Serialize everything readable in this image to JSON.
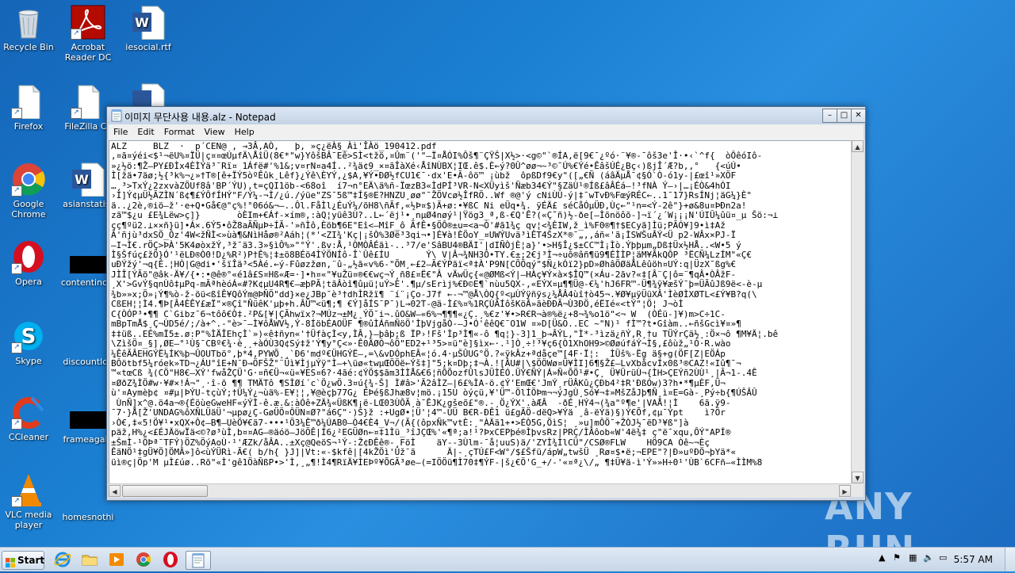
{
  "desktop": {
    "icons": [
      {
        "label": "Recycle Bin"
      },
      {
        "label": "Acrobat Reader DC"
      },
      {
        "label": "iesocial.rtf"
      },
      {
        "label": "Firefox"
      },
      {
        "label": "FileZilla Cli"
      },
      {
        "label": "Google Chrome"
      },
      {
        "label": "asianstatist"
      },
      {
        "label": "Opera"
      },
      {
        "label": "contentinclu"
      },
      {
        "label": "Skype"
      },
      {
        "label": "discountloa"
      },
      {
        "label": "CCleaner"
      },
      {
        "label": "frameagain"
      },
      {
        "label": "VLC media player"
      },
      {
        "label": "homesnothi"
      }
    ]
  },
  "notepad": {
    "title": "이미지 무단사용 내용.alz - Notepad",
    "menu": [
      "File",
      "Edit",
      "Format",
      "View",
      "Help"
    ],
    "buttons": {
      "minimize": "–",
      "maximize": "□",
      "close": "✕"
    },
    "content": "ALZ     BLZ  ·  p´CEN@ , →3Â,AÒ,   þ, »ç¿ëÀ§_Àì'ÎÀö_190412.pdf\n‚¤ã¤ýéi<$¹¬ëU%¤ÏÜ|ç¤¤œÚµfÄ\\ÅîÜ(8€*\"w}YôšBÂ¯Eê>SÌ<tžö,¤Ûm¨('\"—Ï¤ÅÓI%Ôš¶¨ÇŸŠ|X½>·<g©\"`®ÍA,ë[9€¯¿ºó·¨¥®-¯ôš3e'Î·•‹`^f{  òÔêóIô-\n»¿½ö:¶Ž–PY£ÐÌx4ÈÌÝä³¯Rï¤ 1Áfë#'%1&;v¤rN¤a4Í..²¾ä¢9_×¤ãÎàXé‹ÅîNÙBX¦IŒ.ê$.È←ý?0Û^øø¬~³©¯Ú%€Ýé•ÊâšÚÉ¿Bç‹)ßjÎ´Æ?b‚,°   {<úÚ•\nÌ[žä•7äø;½{³k%¬¿»†T®[ê+ÏÝ5òºÊûk¸Lêf}¿Ýê\\ÈYÝ,¿$A,¥Ý•ÐØ½fCU1€¯·dx'E•Ã-ôö™ ¡ùbž  ôpßDf9€y\"([„€Ñ (áâÄµÅ¯¢§Ó`Ò-ó1y-|£œî¹»XÖF\n…¸³>TxÝ¿2zxvàZÖUf8â'BP´ÝU),t=çQI1öb-<68oî  í7¬n°EÄ\\ä%ñ-ÏœzB3«ÌdPÍ³VR-N<XÜyìš'Ñæb34€Ý\"§ZäÙ¹®Íß£âÂÉá—!³fNÀ Ý—›|…¡ÉÒ&4hÓI\n›Ì]Ý¢µÜ½ÃZÌN´ß¢¶£ÝÔfÍHÝ\"F/Ý¼-¬Ì/¿ú./ýüe\"ZS¯5ß™‡Í§®E?HNZU¸øø\"¯ŽÖVcø½ÎfRÖ..Wf ®@'ý cNiÙÛ-ý|‡¯wTvÐ%FœýRÉC←..1¯17}RsÍNj¦äG¼}È\"\nä..¿2è,®iö—ž'·e+Q•Gå€@\"ç%!°06ó&¬—..Ôl.FåÌl¿ÉuÝ¼/õH8\\ñÃf,«½Þ¤$)Ã+ø:•¥ßC Ni eÜq•¾. ÿÉÄ£ séCåÓµÜÐ,Ùç←\"¹n=<Ý-2ê\"}+ø&8u¤ÞÐn2a!\nzã™$¿u £E¾Lëw>ç]}       òÈIm+€Áf-×ím®,:àQ¦yüê3Ù?..L←´ëj¹•¸nµØ4nøý¹|Ÿög3_ª‚ß-€Q'Ê?(«Ç˜ñ)½-ðe[—Ìõnöôõ-]¬ï´¿´W¡¡¡N'ÚIÛ¼ûü¤_µ Šö:¬⊥\nçç¶ºü2.⊥××ñ}ü]•Á×.6Ý5•ôŽ8aÃÑµÞ÷ÍÃ-'»ñÌô,Èöb¶6E\"Eî<—MîF_ô ÃfÊ•§ÖÔ®±u=<a¬Ò'#ã1¾ç qv¦<¾ÈIW,ž_ì%F0®¶†$ECyã]Ìü;PÃÓ¥]9•ì‡Až\nÃ'ñjù³dxSÖ_Ôz'4W<žÑÌ<»ùà¶&NìHåø®²Aáh¦(*'<ZI¾'Kç|¡šÒ%3Øë³3qi¬•]É¥à!ÈÖoY_¤UWÝUvä³ìÊT4ŠzX*®¯„‚,áñ«'ã¡ÌSWŠuÂÝ<Ü p2-WÂx×PJ-Ï\n—I¬Ì€.rÖÇ>ÞÀ'5K4øòxžÝ,³ž¯ä3.3»§ìÔ%»\"°Ý'.ßv:Å,¹ÒMÒÂÉãì-..³7/e'SâBU4®BÄI'|dIÑÒjÈ¦a}'•>H§Î¿$±CC™Ì¡Ìò.Ýþþµm„Dß‡Üx½HÅ..<W•5 ý\nÌ§Šfúç£žÖ}Ó'¹ëLÐ®Ò0!D¿%R²)P†Ê%¦‡±ö8BÉö4ÌÝÖNÍô-Î`Ûê£ÍU       Ý\\ V|Â¬¾NH3Ô•TY.€±;2€j³Ì¬÷uô®âñ¶ü9¶ÉÌÌP¦äM¥ÂkQÔP ³ËCÑ¼LzÍM\"«Ç€\nuÐÝžý'¬q{É.¦HÒ|G@di•'šïÎä³<5Àé.←ý-Fûøzžøn,¨û-„½ã«v%6-\"ÕM¸←£2—Ã€ÝPãï<ª‡À'P9N[CÕÕqý\"$Ñ¿kÓï2}pD»ØhâÖØäÅLêûöh¤UÝ:q|ÜzX¯ßg%€\nJÌÎ[ÝÃö\"@âk-Ä¥/{•:•@ê®°«é1â£S¤Hß«Æ=·]•h¤«\"¥uŽü¤®€€wç¬Ý¸ñ8£¤Ë€\"Â vÄwÜç{«@ØMß<Ý|—HÀç¥Ý×à×$ÎQ™(×Áu-2ãv?«‡[Â¨Ç|ô=¨¶qÂ•ÒÂžF-\n¸X'>GvÝ§qnÙô‡µPq-mÃªhèóÁ«#?K¢µU4R¶€—æþPÃ¦tãÂòî¶ûµü¦uÝ>È'.¶µ/sErìj%€Ð©E¶`nùu5QX-,«EÝX¤µ¶¶Ü@-€¼'hJ6FR™-Ü¶¾ÿ¥æšÝ¯þ=ÜÃûJß9ë<-è-µ\n¾b»»x;Ö»¡Ý¶%ò-ž-öü<ßîÊ¥QôÝm@ÞÑÖ\"dd}×e¿JBp¯è³†dhÌRžï¶ ¨í¨¡Ço-J7f ←-¬™@Å\\ÒQ{º<µÙÝÿñÿs¿¼ÅÂ4ùî†ò45¬.¥Ø¥µÿÜüXÂ'ÌèØÌXØTL<£Ý¥B?q(\\\nCßEH¦¦Ì4.¶Þ[Â4ÈÊY£æÏ\"×®Çî\"ÑüêK'µþ+h.ÂÜ™<ü¶;¶ €Ý]åÍS¯P¯)L→02T-@ä-Ì£%¤%1RÇÙÃÍôšKöÂ»ãèÐÐÃ¬Ù3ÐÖ,éËIé«<tÝ\"¦Ö¦ J¬òÌ\nC{ÒÓP³•¶¶ C`Gibz¯6¬tôô€Ò‡.²P&[¥|ÇÃhwïx?¬MÚz¬±M¿¸ÝÖ¯i¬.ûO&W—«6%¬¶¶¶«¿Ç.¸%€z'¥•>R€R¬à®%ë¿+8¬¾%o1ö\"<¬ W  (ÒÉü-]¥)m>C÷1C-\nmBpTmÅ$¸Ç¬ÙD5é/;/à+^.-\"è>¯—Ì¥ôÅWV½,Ý-8ÍöbÉAOÜF ¶®ûÌÁñmÑöÖ'ÌþVjgåÒ-—J•Ó'êêQ€¯O1W ¤»D[Ü&O..EC ~\"N)¹ fÌ™?t•Gîàm..←ñšGcì¥¤»¶\n‡‡üß..EÉ%mÏ5±.ø:P\"%ÌÄÎEhçÌ`»)«ê‡ñyn«'†ÜfàçÌ<y,ÌÂ,}—þâþ;ß ÏP›!Fš'Ìp³Ì¶«-ô ¶q¦}-3]1_þ→ÂÝL,\"Ì*-³ìzä¿ñÝ,R¸†u TÜÝrÇä½¸:Ö×¬ô ¶M¥Ä¦.bê\n\\ZìšÖ¤_§],ØE—°¹Ù§¯CBº€¾·è¸¸+àÓÙ3Q¢Sý‡ž'Ý¶y°Ç<»·Ê0ÄØÓ¬ôÖ\"ED2+¹³5>¤ü\"è]§ìx←·.¹]Ò¸÷!³¥ç6{Ò1XhOH9>©ØøúfáÝ¬Ì§,£ôùž„¹Ò·R.wào\n¼ÊêÃÂEHGÝË¼ÍK%þ¬ÛOUTbö°,þ*4,PYWÕ¸¸`Ð6'mdº€ÜHGÝË—,=\\&vDÓphEÂ«¦ó.4·µŠÛUG°Ö.?«ÿkÂz+ªdåçe™[4F·Ï¦:  ÌÜš%-Ëg ä§+g(ÖF[Z|EÖÁp\nBÔötbf5¼róek»TD¬¿ÁU°îE+N¯Ð→ÖFŠŽ°¨Üì¥ÌjµÝÿ\"Ì—+\\üø«twµŒÖÖë←Ýš‡]\"5;k¤Dþ;‡¬À.![ÂU#|\\$ÖÖWø¤Ü¥ÌI]6¶§Ž£—LvXbåcvÍx0ß³®CAZ!«Iû¶¯¬\n™«tœCß ¾(CÖ\"H8€—XÝ'fwåŽÇÜ'G·¤ñ€Ü¬«ü«¥ES¤6?·4ãé:¢ÝÖ$$ãm3ÌÌÅ&€6¦ñÕÕozfÛlsJÜÌÉÓ.ÜÝ€ÑÝ|Á»Ñ«ÕÖ¹#•Ç¸ Ü¥ÜrüÙ¬{ÌH>ÇEÝñ2ÙÙ¹¸|Ã¬1-.4Ê\n¤ØðZ¾ÌÖ#w·¥#×!Á¬\"¸·î-õ ¶¶ TMÄTô ¶SÌØí´c`Ö¿wÖ.3¤ú{¾-Š] Ì#â>'Ã2âÌZ—|6£%ÌA-ö.¢Ý'EmŒ€'JmÝ¸rÜÂKû¿ÇÐb4²‡R'ÐßÓw)3?h•*¶µÈF,Ü¬\nù'¤Aymèþ¢ ¤#µ|ÞÝU-tçùÝ;†Ü¼Ý¿¬ùä%-E¥¦¦,¥@èçþ77G¿ ÉÞé§ßJhæ8v¦mö.¡15U òýçü,¥'Ü™-ÖlÍÖÞm¬¬ýJgÙ¸Só¥¬‡»MšZåJþ¶Ñ¸ì¤E=Gà-¸Pý÷b{¶ÚŠÂÛ\n ÙnÑ]x^@.ö4a¬®{ÉöùeGweHF«ýÝÌ-ê.æ.&:àÓê+ZÄ¾«ÜßK¶¡ë-LŒ03ÙÔÃ¸à¯ÊJK¿gšeõ£\"®.-¸Ö¿ÝX'.àÆÂ  -ðÉ¸HÝ4¬(¾a\"º¶e'|VAÅ!¦Ì    6ã.ÿ9-\n¯7·}Å[Ž'UNDAG%ôXÑLÜäÜ'¬µpø¿Ç-GøÜÖ¤ÔÜN¤Ø?\"á6Ç\"·)Š}ž :+UgØ•¦Ü'¦4™-ÙÜ B€R-ÐÊ1 ü£gÃÖ-dëQ>¥Ýä ¸â-ëÝä)§)Ý€Õf,¢µ¯Ýpt    ì?Ör\n›Ò€,‡«5!Ö¥¹•xQX+Ô¢—B¶—UèÖ¥€ä7-•••¹Ö3¼Ê™ð¼ÚAB0—Ò4€È4_V¬/(Ã{(ôpxÑk™vtÈ:¸\"ÀÄä1+•>ÉÒ5G,ÖìS¦ ¸»u]mÔÖ¯+ŽÒJ½¯ëD³¥ß\"]à\npäž,H%¿<£ÉJÄöwÏä<©?ø³ùÌ,b¤¤AG—®äóö—JöÖÊ|Í6¿²EGÜØn←¤‡1Ìü_³îJÇŒ%'«¶ª;a!¹?ÞxCEPþé®ÌþvsRz|PRÇ/ÌÂôob«W'4ë¾‡ ç\"ë¯xqu,ÔÝ\"APÍ®\n±ŠmÌ-¹ÖÞª¯TFÝ)ÖZ%ÖýAoÙ·¹'ÆZk/åÂA..±Xç@QeöS¬¹Ý-:Ž¢ÐÊê®-¸FöÌ    äY--3Ùlm-¯å¦uuS)ä/'ZYÌ¾ÌlCÜ\"/CSØ®FLW    HÖ9CA Òê~¬Èç\nÊãNÖ¹‡gÜ¥Ö]ÖMÂ»]ô<ùÝÜRì-Ã€( b/h{ }J]|Vt:«-$kfê|[4kŽÖì'Ûž¯ã      Ä|-¸çTÚ£F<W°/$£Šfü/ápW„twšÜ ¸Rø¤$•ë;¬EPE\"?|Ð»uºÐÖ¬þYä*«\nüì®ç|Öp'M µÌ£úø..Rõ\"«Ì'gê1ÖàÑßP•>'Ì,¸„¶!Ì4¶RïÄ¥ÌEÞº¥ÕGÃ³øe—(=IÖÖü¶Ì70‡¶ÝF-|š¿€Ö'G_+/-'«¤ª¿\\/„ ¶‡Ü¥ä-ì'Ý»»H÷0¹'ÙB`6CFñ—«ÌÌM%8"
  },
  "taskbar": {
    "start_label": "Start",
    "clock": "5:57 AM"
  },
  "watermark": "ANY RUN"
}
